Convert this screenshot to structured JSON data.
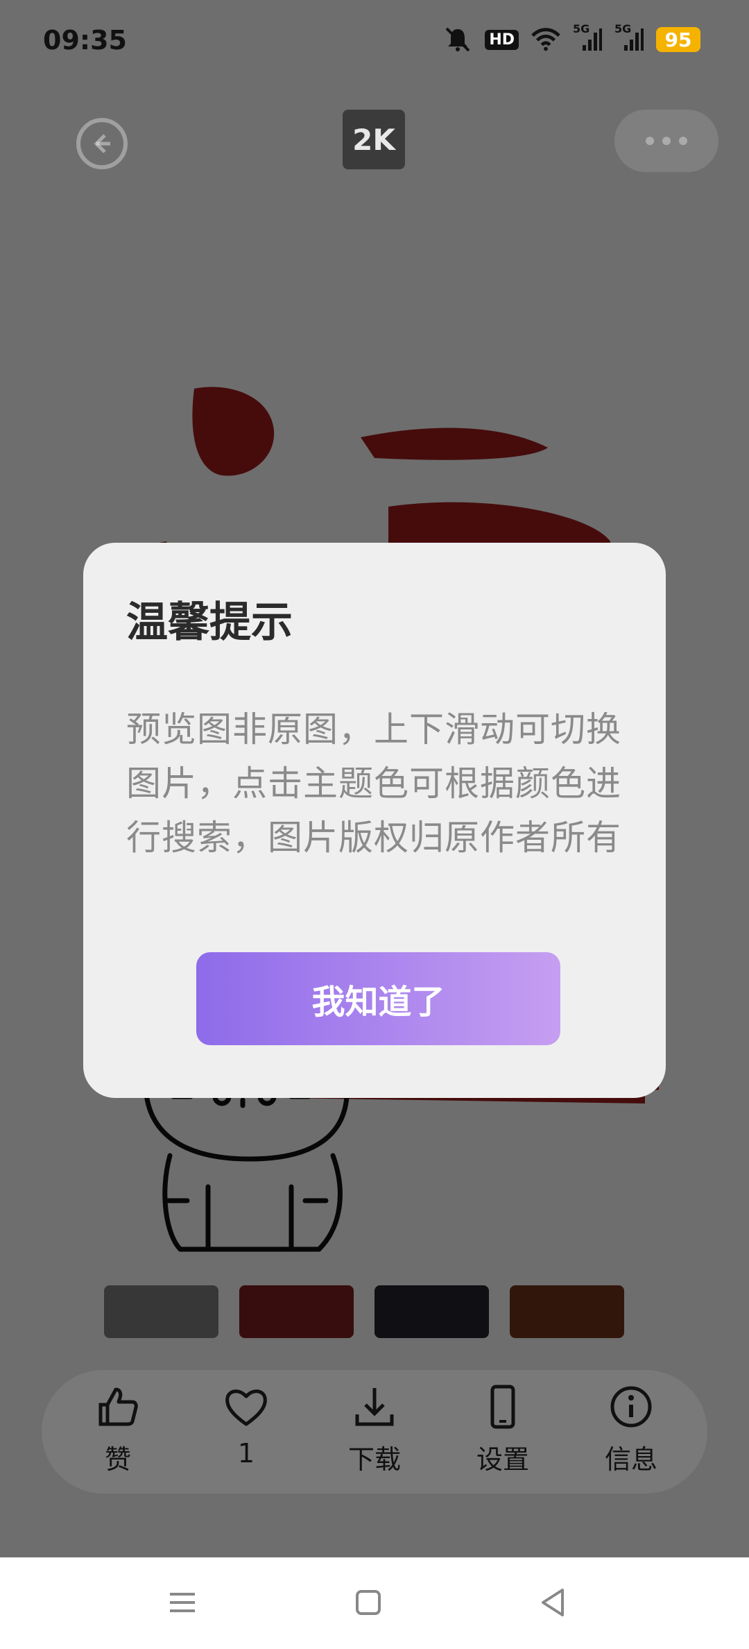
{
  "status_bar": {
    "time": "09:35",
    "icons": [
      "bell-muted-icon",
      "hd-icon",
      "wifi-icon",
      "signal-5g-icon",
      "signal-5g-icon",
      "battery-icon"
    ],
    "hd_label": "HD",
    "network_1": "5G",
    "network_2": "5G",
    "battery": "95"
  },
  "header": {
    "resolution": "2K"
  },
  "color_swatches": [
    "#7b7b7b",
    "#7a1e1e",
    "#24222b",
    "#6e3219"
  ],
  "toolbar": {
    "like": "赞",
    "favorite_count": "1",
    "download": "下载",
    "settings": "设置",
    "info": "信息"
  },
  "dialog": {
    "title": "温馨提示",
    "message": "预览图非原图，上下滑动可切换图片，点击主题色可根据颜色进行搜索，图片版权归原作者所有",
    "confirm": "我知道了"
  },
  "colors": {
    "accent_start": "#8e6bea",
    "accent_end": "#c69ef1",
    "art_red": "#9b1c1c"
  }
}
